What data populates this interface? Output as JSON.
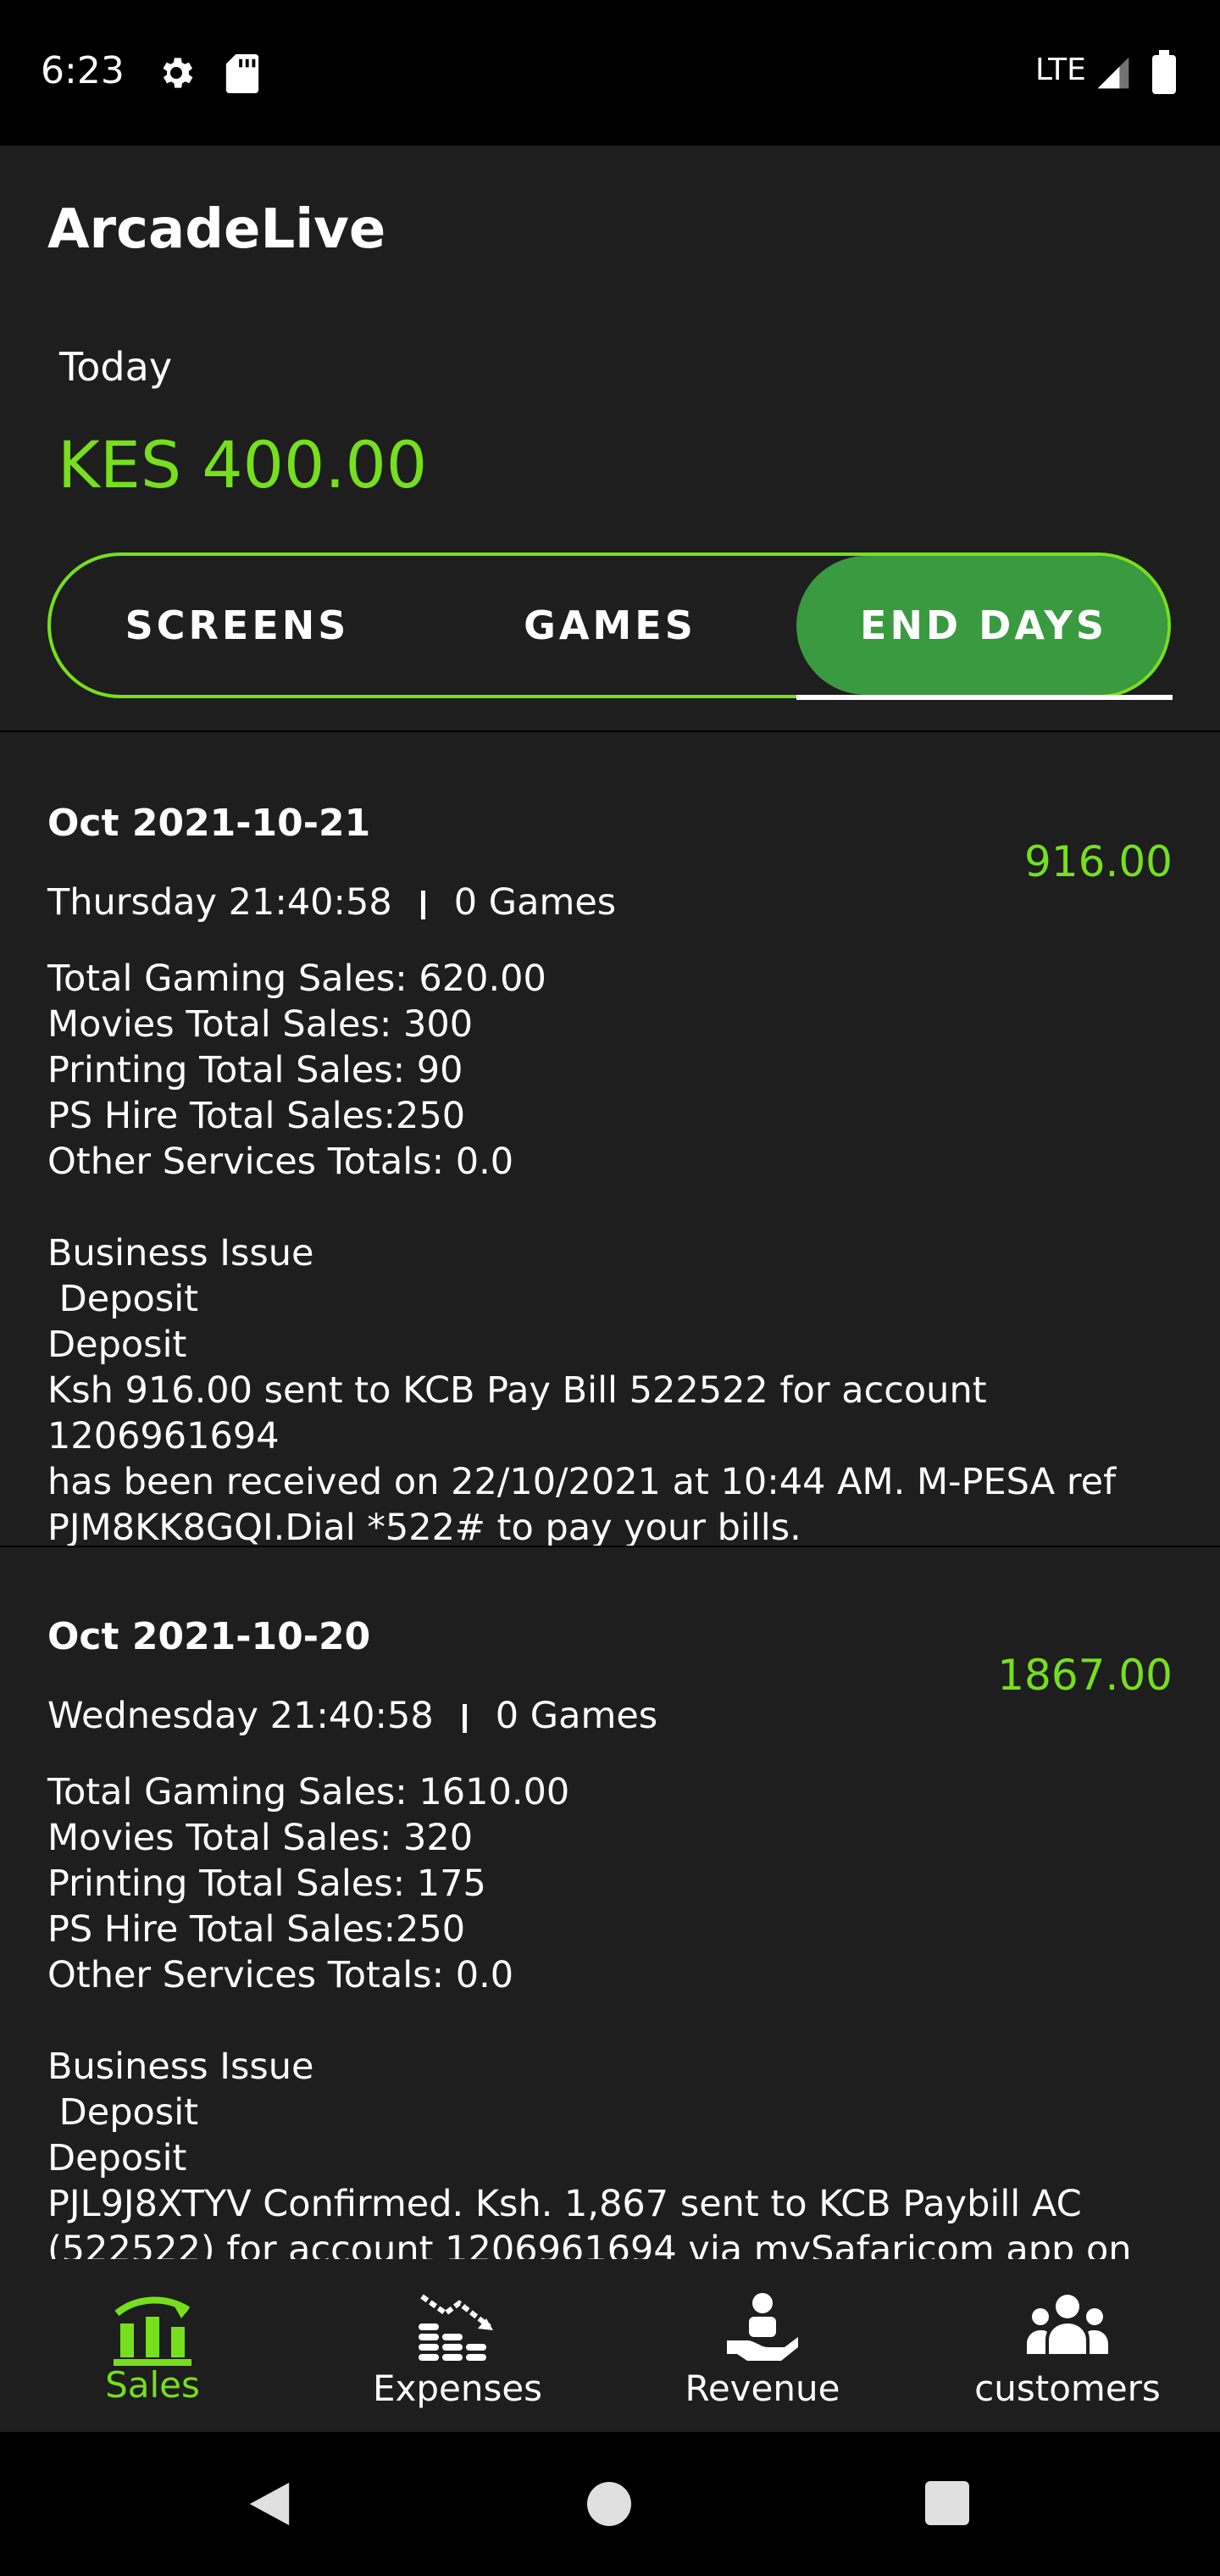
{
  "status_bar": {
    "time": "6:23",
    "network": "LTE"
  },
  "app": {
    "title": "ArcadeLive"
  },
  "summary": {
    "period_label": "Today",
    "amount": "KES 400.00"
  },
  "tabs": [
    {
      "label": "SCREENS",
      "selected": false
    },
    {
      "label": "GAMES",
      "selected": false
    },
    {
      "label": "END DAYS",
      "selected": true
    }
  ],
  "entries": [
    {
      "date": "Oct 2021-10-21",
      "amount": "916.00",
      "day_time": "Thursday 21:40:58",
      "games": "0 Games",
      "lines": "Total Gaming Sales: 620.00\nMovies Total Sales: 300\nPrinting Total Sales: 90\nPS Hire Total Sales:250\nOther Services Totals: 0.0\n\nBusiness Issue\n Deposit\nDeposit\nKsh 916.00 sent to KCB Pay Bill 522522 for account 1206961694\nhas been received on 22/10/2021 at 10:44 AM. M-PESA ref\nPJM8KK8GQI.Dial *522# to pay your bills."
    },
    {
      "date": "Oct 2021-10-20",
      "amount": "1867.00",
      "day_time": "Wednesday 21:40:58",
      "games": "0 Games",
      "lines": "Total Gaming Sales: 1610.00\nMovies Total Sales: 320\nPrinting Total Sales: 175\nPS Hire Total Sales:250\nOther Services Totals: 0.0\n\nBusiness Issue\n Deposit\nDeposit\nPJL9J8XTYV Confirmed. Ksh. 1,867 sent to KCB Paybill AC\n(522522) for account 1206961694 via mySafaricom app on"
    }
  ],
  "bottom_nav": [
    {
      "label": "Sales",
      "icon": "bar-chart-icon",
      "active": true
    },
    {
      "label": "Expenses",
      "icon": "coins-trend-down-icon",
      "active": false
    },
    {
      "label": "Revenue",
      "icon": "hand-receiving-icon",
      "active": false
    },
    {
      "label": "customers",
      "icon": "group-people-icon",
      "active": false
    }
  ],
  "colors": {
    "accent": "#76e01c",
    "tab_selected": "#3a9a40",
    "background": "#1e1e1e"
  }
}
